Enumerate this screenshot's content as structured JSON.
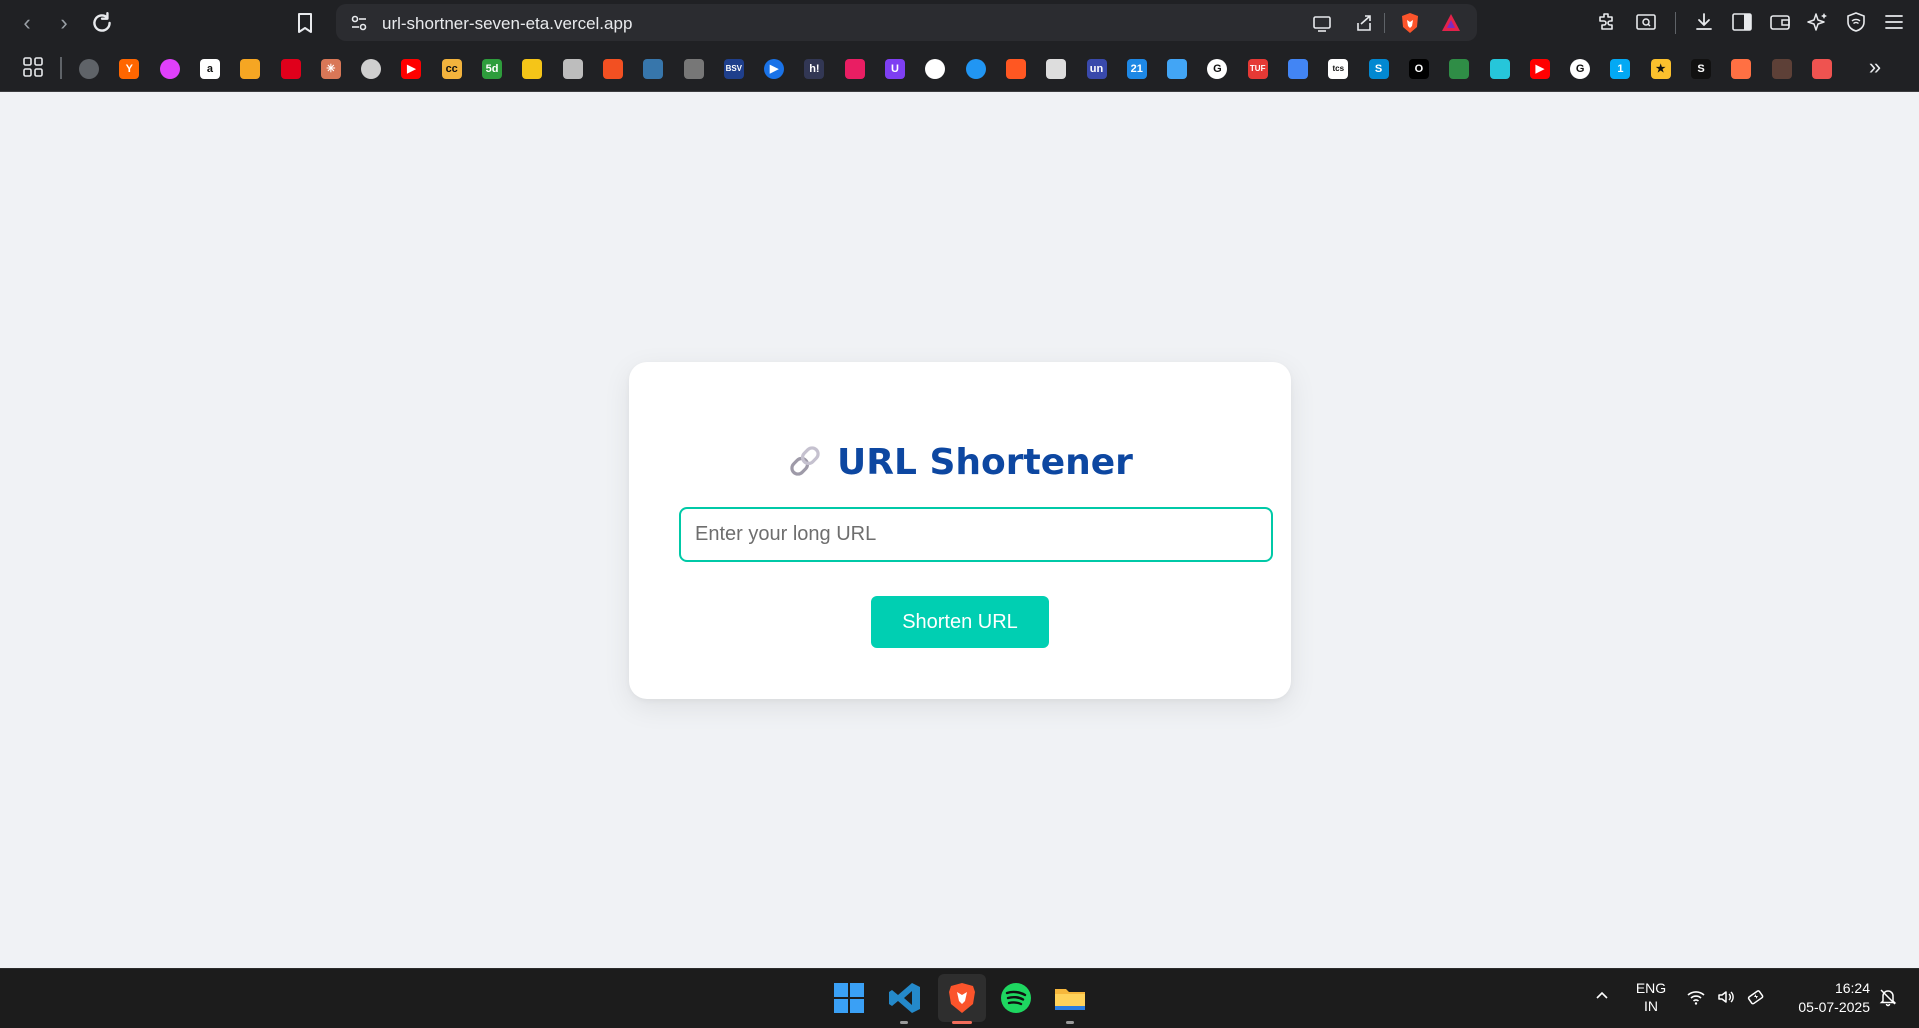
{
  "browser": {
    "url": "url-shortner-seven-eta.vercel.app",
    "nav": {
      "back_icon": "back-arrow-icon",
      "forward_icon": "forward-arrow-icon",
      "reload_icon": "reload-icon"
    },
    "bookmarks": [
      {
        "name": "globe",
        "label": "",
        "color": "#5f6368"
      },
      {
        "name": "ycombinator",
        "label": "Y",
        "color": "#ff6600"
      },
      {
        "name": "circle-app",
        "label": "",
        "color": "#e040fb"
      },
      {
        "name": "amazon",
        "label": "a",
        "color": "#ffffff"
      },
      {
        "name": "nptel",
        "label": "",
        "color": "#f5a623"
      },
      {
        "name": "oracle",
        "label": "",
        "color": "#e0001b"
      },
      {
        "name": "claude",
        "label": "✳",
        "color": "#d97757"
      },
      {
        "name": "chess",
        "label": "",
        "color": "#cfcfcf"
      },
      {
        "name": "youtube",
        "label": "▶",
        "color": "#ff0000"
      },
      {
        "name": "cc",
        "label": "cc",
        "color": "#f2b33d"
      },
      {
        "name": "5d",
        "label": "5d",
        "color": "#2e9d3c"
      },
      {
        "name": "key",
        "label": "",
        "color": "#f5c518"
      },
      {
        "name": "news",
        "label": "",
        "color": "#bdbdbd"
      },
      {
        "name": "microsoft",
        "label": "",
        "color": "#f25022"
      },
      {
        "name": "python",
        "label": "",
        "color": "#3776ab"
      },
      {
        "name": "cisco",
        "label": "",
        "color": "#777777"
      },
      {
        "name": "bsv",
        "label": "BSV",
        "color": "#1f3f8c"
      },
      {
        "name": "play",
        "label": "▶",
        "color": "#1a73e8"
      },
      {
        "name": "hackerearth",
        "label": "h!",
        "color": "#323754"
      },
      {
        "name": "unstop",
        "label": "",
        "color": "#e91e63"
      },
      {
        "name": "udemy",
        "label": "U",
        "color": "#7e3ff2"
      },
      {
        "name": "openai",
        "label": "",
        "color": "#ffffff"
      },
      {
        "name": "gemini-app",
        "label": "",
        "color": "#2196f3"
      },
      {
        "name": "arrow-app",
        "label": "",
        "color": "#ff5722"
      },
      {
        "name": "agency",
        "label": "",
        "color": "#dddddd"
      },
      {
        "name": "un",
        "label": "un",
        "color": "#3949ab"
      },
      {
        "name": "calendar",
        "label": "21",
        "color": "#1e88e5"
      },
      {
        "name": "fish",
        "label": "",
        "color": "#42a5f5"
      },
      {
        "name": "google",
        "label": "G",
        "color": "#ffffff"
      },
      {
        "name": "tuf",
        "label": "TUF",
        "color": "#e53935"
      },
      {
        "name": "gcloud",
        "label": "",
        "color": "#4285f4"
      },
      {
        "name": "tcs",
        "label": "tcs",
        "color": "#ffffff"
      },
      {
        "name": "s-app",
        "label": "S",
        "color": "#0288d1"
      },
      {
        "name": "o-app",
        "label": "O",
        "color": "#000000"
      },
      {
        "name": "gfg",
        "label": "",
        "color": "#2f8d46"
      },
      {
        "name": "pair",
        "label": "",
        "color": "#26c6da"
      },
      {
        "name": "youtube-2",
        "label": "▶",
        "color": "#ff0000"
      },
      {
        "name": "google-2",
        "label": "G",
        "color": "#ffffff"
      },
      {
        "name": "one-app",
        "label": "1",
        "color": "#03a9f4"
      },
      {
        "name": "star-app",
        "label": "★",
        "color": "#fbc02d"
      },
      {
        "name": "s-black",
        "label": "S",
        "color": "#111111"
      },
      {
        "name": "box-app",
        "label": "",
        "color": "#ff7043"
      },
      {
        "name": "dark-app",
        "label": "",
        "color": "#5d4037"
      },
      {
        "name": "eraser-app",
        "label": "",
        "color": "#ef5350"
      }
    ]
  },
  "app": {
    "title": "URL Shortener",
    "input_placeholder": "Enter your long URL",
    "input_value": "",
    "button_label": "Shorten URL",
    "accent_color": "#00cfb2",
    "title_color": "#0d47a1"
  },
  "taskbar": {
    "apps": [
      "windows-start-icon",
      "vscode-icon",
      "brave-icon",
      "spotify-icon",
      "file-explorer-icon"
    ],
    "lang_line1": "ENG",
    "lang_line2": "IN",
    "time": "16:24",
    "date": "05-07-2025"
  }
}
